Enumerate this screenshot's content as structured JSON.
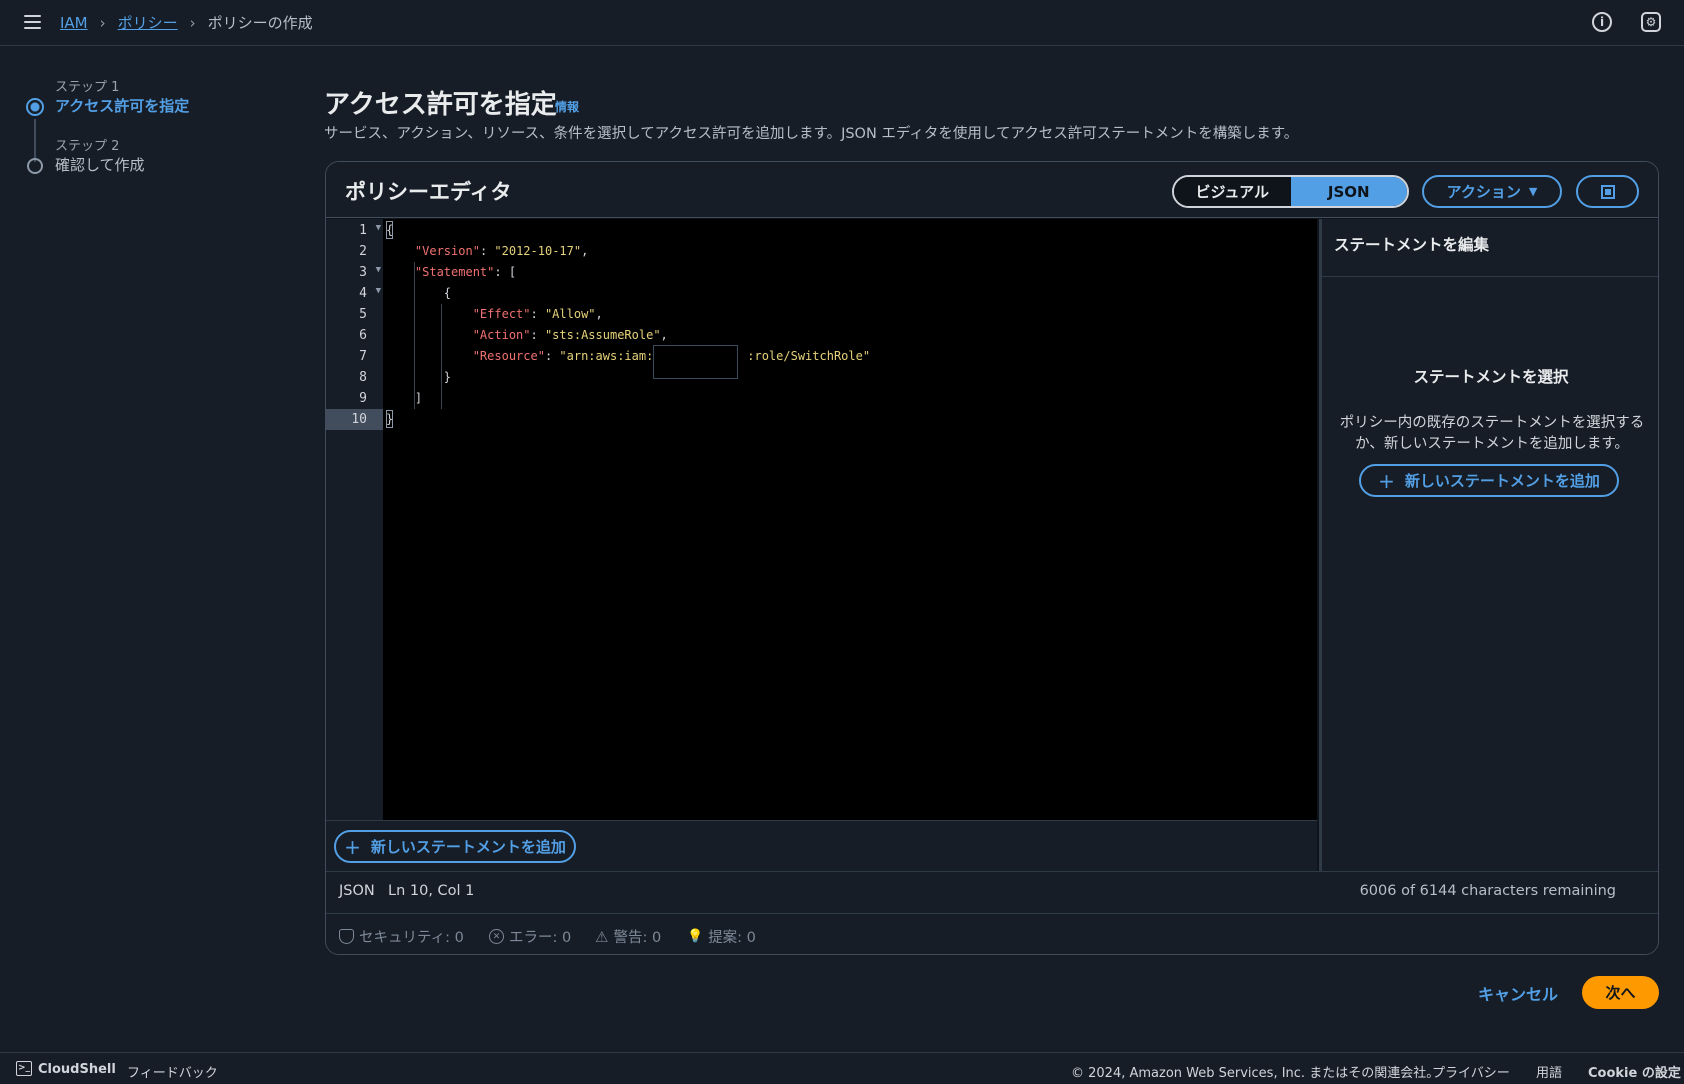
{
  "header": {
    "menu_icon": "hamburger-menu-icon",
    "breadcrumb": [
      {
        "label": "IAM"
      },
      {
        "label": "ポリシー"
      },
      {
        "label": "ポリシーの作成"
      }
    ],
    "info_icon": "info-icon",
    "settings_icon": "settings-icon"
  },
  "steps": [
    {
      "label": "ステップ 1",
      "title": "アクセス許可を指定",
      "state": "active"
    },
    {
      "label": "ステップ 2",
      "title": "確認して作成",
      "state": "inactive"
    }
  ],
  "main": {
    "title": "アクセス許可を指定",
    "info_link": "情報",
    "description": "サービス、アクション、リソース、条件を選択してアクセス許可を追加します。JSON エディタを使用してアクセス許可ステートメントを構築します。"
  },
  "editor": {
    "title": "ポリシーエディタ",
    "mode_visual": "ビジュアル",
    "mode_json": "JSON",
    "selected_mode": "JSON",
    "actions_label": "アクション",
    "code_lines": [
      "{",
      "    \"Version\": \"2012-10-17\",",
      "    \"Statement\": [",
      "        {",
      "            \"Effect\": \"Allow\",",
      "            \"Action\": \"sts:AssumeRole\",",
      "            \"Resource\": \"arn:aws:iam::            :role/SwitchRole\"",
      "        }",
      "    ]",
      "}"
    ],
    "line_numbers": [
      "1",
      "2",
      "3",
      "4",
      "5",
      "6",
      "7",
      "8",
      "9",
      "10"
    ],
    "active_line": 10,
    "add_statement_label": "新しいステートメントを追加",
    "status": {
      "format": "JSON",
      "position": "Ln 10, Col 1",
      "remaining": "6006 of 6144 characters remaining"
    },
    "lint": {
      "security": "セキュリティ: 0",
      "errors": "エラー: 0",
      "warnings": "警告: 0",
      "suggestions": "提案: 0"
    }
  },
  "right_panel": {
    "title": "ステートメントを編集",
    "empty_title": "ステートメントを選択",
    "empty_desc": "ポリシー内の既存のステートメントを選択するか、新しいステートメントを追加します。",
    "add_statement_label": "新しいステートメントを追加"
  },
  "actions": {
    "cancel": "キャンセル",
    "next": "次へ"
  },
  "footer": {
    "cloudshell": "CloudShell",
    "feedback": "フィードバック",
    "copyright": "© 2024, Amazon Web Services, Inc. またはその関連会社。",
    "privacy": "プライバシー",
    "terms": "用語",
    "cookies": "Cookie の設定"
  },
  "colors": {
    "accent": "#539fe5",
    "primary_button": "#ff9900",
    "background": "#161d26",
    "code_key": "#f07171",
    "code_string": "#e6d27a"
  }
}
